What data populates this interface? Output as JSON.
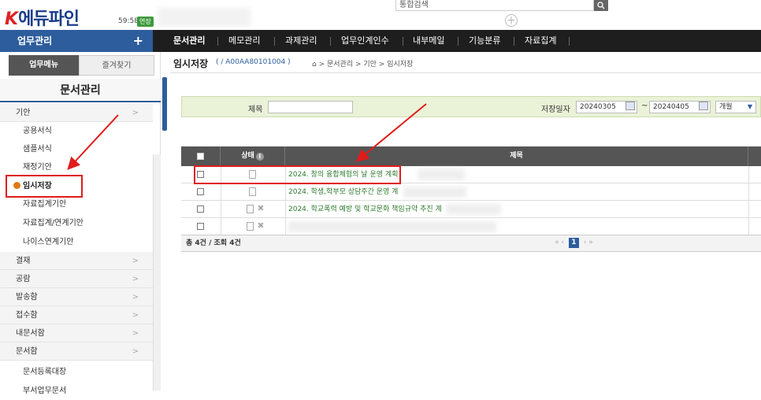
{
  "header": {
    "logo_k": "K",
    "logo_text": "에듀파인",
    "timer": "59:58",
    "extend_label": "연장",
    "search_placeholder": "통합검색",
    "search_icon": "search-icon",
    "add_icon": "plus-circle-icon"
  },
  "nav": {
    "left_label": "업무관리",
    "left_plus": "+",
    "items": [
      "문서관리",
      "메모관리",
      "과제관리",
      "업무인계인수",
      "내부메일",
      "기능분류",
      "자료집계"
    ]
  },
  "sidebar": {
    "tabs": [
      "업무메뉴",
      "즐겨찾기"
    ],
    "title": "문서관리",
    "section_draft": "기안",
    "draft_items": [
      "공용서식",
      "샘플서식",
      "재정기안",
      "임시저장",
      "자료집계기안",
      "자료집계/연계기안",
      "나이스연계기안"
    ],
    "active_item": "임시저장",
    "sections": [
      "결재",
      "공람",
      "발송함",
      "접수함",
      "내문서함",
      "문서함"
    ],
    "doc_items": [
      "문서등록대장",
      "부서업무문서"
    ]
  },
  "main": {
    "title": "임시저장",
    "doc_code": "A00AA80101004",
    "breadcrumb": [
      "문서관리",
      "기안",
      "임시저장"
    ]
  },
  "filter": {
    "title_label": "제목",
    "title_value": "",
    "date_label": "저장일자",
    "date_from": "20240305",
    "date_to": "20240405",
    "date_sep": "~",
    "period": "개월"
  },
  "table": {
    "headers": [
      "상태",
      "제목"
    ],
    "rows": [
      {
        "title": "2024. 창의 융합체험의 날 운영 계획",
        "attachment": false
      },
      {
        "title": "2024. 학생,학부모 상담주간 운영 계",
        "attachment": false
      },
      {
        "title": "2024. 학교폭력 예방 및 학교문화 책임규약 추진 계",
        "attachment": true
      },
      {
        "title": "",
        "attachment": true
      }
    ],
    "summary": "총 4건 / 조회 4건",
    "current_page": "1"
  },
  "colors": {
    "nav_blue": "#2d5d9c",
    "nav_dark": "#1e1e1e",
    "title_green": "#2e7a2e",
    "annotation_red": "#e01c1c",
    "active_dot": "#e07818"
  }
}
